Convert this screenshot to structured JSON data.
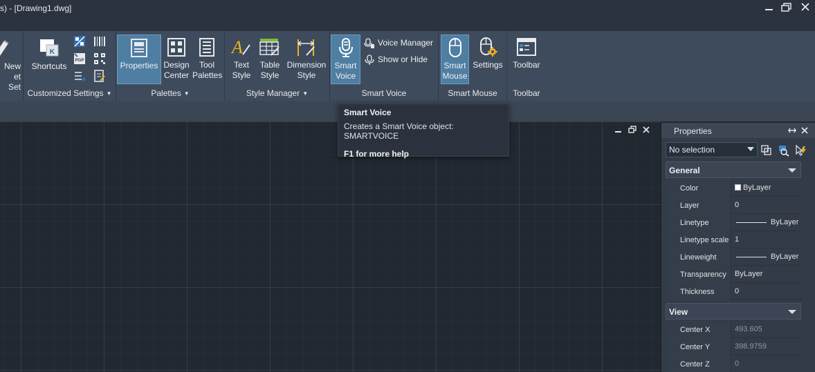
{
  "window": {
    "title": "s) - [Drawing1.dwg]"
  },
  "ribbon": {
    "groups": [
      {
        "label": "Customized Settings",
        "buttons": [
          {
            "label": "Shortcuts"
          }
        ]
      },
      {
        "label": "Palettes",
        "buttons": [
          {
            "label_lines": [
              "Properties"
            ]
          },
          {
            "label_lines": [
              "Design",
              "Center"
            ]
          },
          {
            "label_lines": [
              "Tool",
              "Palettes"
            ]
          }
        ]
      },
      {
        "label": "Style Manager",
        "buttons": [
          {
            "label_lines": [
              "Text",
              "Style"
            ]
          },
          {
            "label_lines": [
              "Table",
              "Style"
            ]
          },
          {
            "label_lines": [
              "Dimension",
              "Style"
            ]
          }
        ]
      },
      {
        "label": "Smart Voice",
        "buttons": [
          {
            "label_lines": [
              "Smart",
              "Voice"
            ]
          }
        ],
        "small_buttons": [
          {
            "label": "Voice Manager"
          },
          {
            "label": "Show or Hide"
          }
        ]
      },
      {
        "label": "Smart Mouse",
        "buttons": [
          {
            "label_lines": [
              "Smart",
              "Mouse"
            ]
          },
          {
            "label_lines": [
              "Settings"
            ]
          }
        ]
      },
      {
        "label": "Toolbar",
        "buttons": [
          {
            "label_lines": [
              "Toolbar"
            ]
          }
        ]
      }
    ],
    "partial_left": {
      "line1": "New",
      "line2": "et Set"
    }
  },
  "tooltip": {
    "title": "Smart Voice",
    "description": "Creates a Smart Voice object: SMARTVOICE",
    "help": "F1 for more help"
  },
  "properties": {
    "title": "Properties",
    "selection": "No selection",
    "sections": [
      {
        "name": "General",
        "rows": [
          {
            "key": "Color",
            "value": "ByLayer"
          },
          {
            "key": "Layer",
            "value": "0"
          },
          {
            "key": "Linetype",
            "value": "ByLayer"
          },
          {
            "key": "Linetype scale",
            "value": "1"
          },
          {
            "key": "Lineweight",
            "value": "ByLayer"
          },
          {
            "key": "Transparency",
            "value": "ByLayer"
          },
          {
            "key": "Thickness",
            "value": "0"
          }
        ]
      },
      {
        "name": "View",
        "rows": [
          {
            "key": "Center X",
            "value": "493.605"
          },
          {
            "key": "Center Y",
            "value": "398.9759"
          },
          {
            "key": "Center Z",
            "value": "0"
          }
        ]
      }
    ]
  },
  "colors": {
    "accent_active": "#4f7ea3",
    "ribbon_bg": "#3e4b5c",
    "canvas_bg": "#212830",
    "settings_gear": "#f2b01e",
    "text_style_a": "#f2b01e"
  }
}
